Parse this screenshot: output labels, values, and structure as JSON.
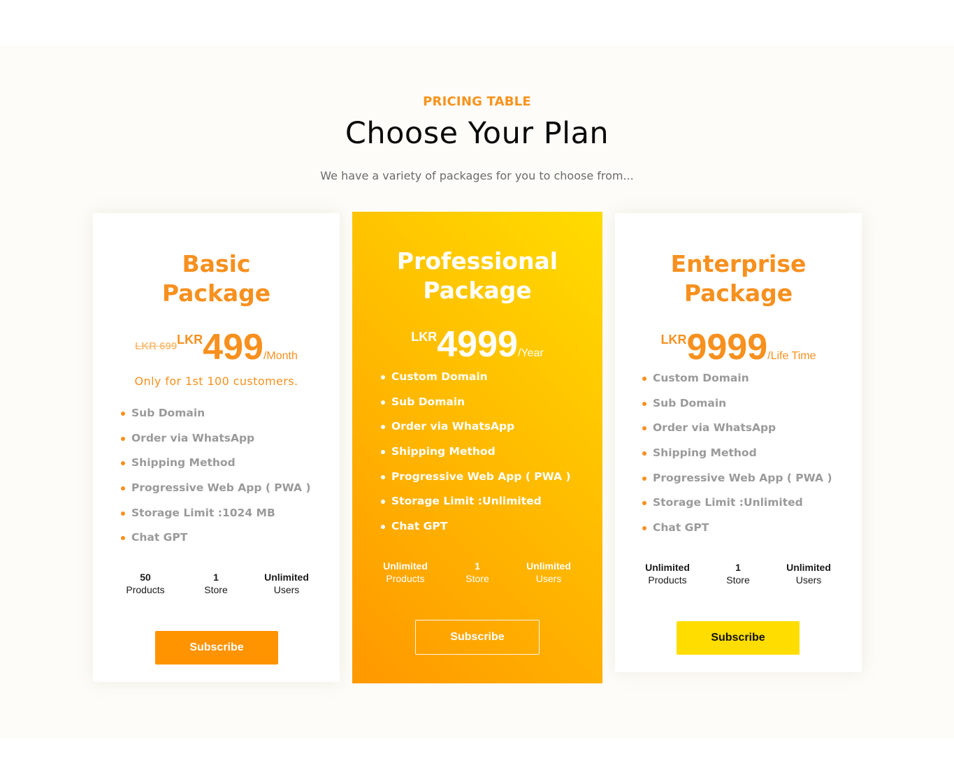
{
  "header": {
    "eyebrow": "PRICING TABLE",
    "title": "Choose Your Plan",
    "subtitle": "We have a variety of packages for you to choose from..."
  },
  "colors": {
    "accent_orange": "#f7901e",
    "button_orange": "#ff9300",
    "button_yellow": "#ffdd00",
    "gradient_top": "#ffdc00",
    "gradient_bottom": "#ff9800",
    "section_bg": "#fdfcf8"
  },
  "plans": [
    {
      "name_line1": "Basic",
      "name_line2": "Package",
      "old_price": "LKR 699",
      "currency": "LKR",
      "amount": "499",
      "period": "/Month",
      "note": "Only for 1st 100 customers.",
      "features": [
        "Sub Domain",
        "Order via WhatsApp",
        "Shipping Method",
        "Progressive Web App ( PWA )",
        "Storage Limit :1024 MB",
        "Chat GPT"
      ],
      "stats": [
        {
          "value": "50",
          "label": "Products"
        },
        {
          "value": "1",
          "label": "Store"
        },
        {
          "value": "Unlimited",
          "label": "Users"
        }
      ],
      "button": "Subscribe"
    },
    {
      "name_line1": "Professional",
      "name_line2": "Package",
      "currency": "LKR",
      "amount": "4999",
      "period": "/Year",
      "features": [
        "Custom Domain",
        "Sub Domain",
        "Order via WhatsApp",
        "Shipping Method",
        "Progressive Web App ( PWA )",
        "Storage Limit :Unlimited",
        "Chat GPT"
      ],
      "stats": [
        {
          "value": "Unlimited",
          "label": "Products"
        },
        {
          "value": "1",
          "label": "Store"
        },
        {
          "value": "Unlimited",
          "label": "Users"
        }
      ],
      "button": "Subscribe"
    },
    {
      "name_line1": "Enterprise",
      "name_line2": "Package",
      "currency": "LKR",
      "amount": "9999",
      "period": "/Life Time",
      "features": [
        "Custom Domain",
        "Sub Domain",
        "Order via WhatsApp",
        "Shipping Method",
        "Progressive Web App ( PWA )",
        "Storage Limit :Unlimited",
        "Chat GPT"
      ],
      "stats": [
        {
          "value": "Unlimited",
          "label": "Products"
        },
        {
          "value": "1",
          "label": "Store"
        },
        {
          "value": "Unlimited",
          "label": "Users"
        }
      ],
      "button": "Subscribe"
    }
  ]
}
